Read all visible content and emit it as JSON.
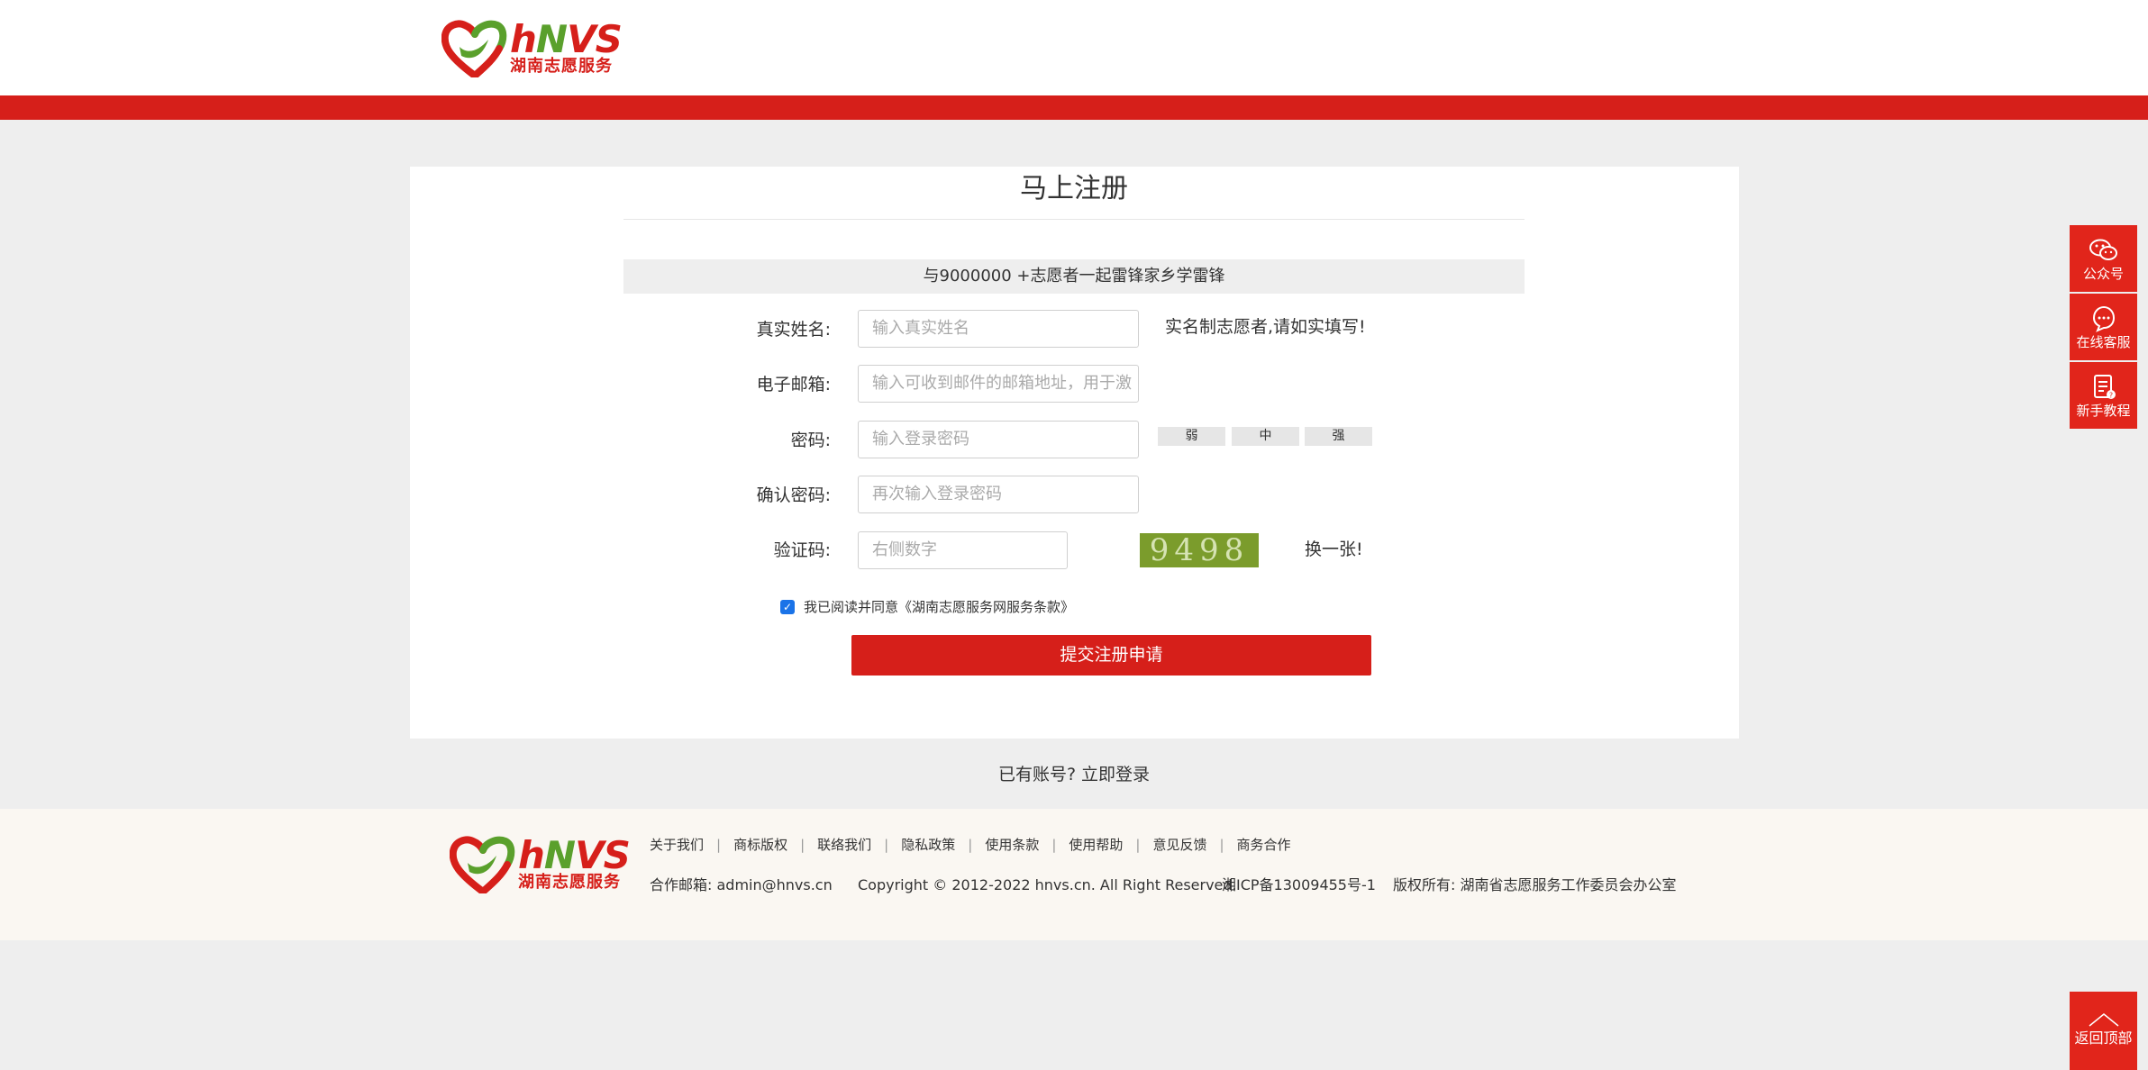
{
  "header": {
    "logo": {
      "brand_h": "h",
      "brand_n": "N",
      "brand_vs": "VS",
      "sub": "湖南志愿服务"
    }
  },
  "colors": {
    "brand_red": "#d61f1a",
    "brand_green": "#5aa02c",
    "side_red": "#e1251b"
  },
  "form": {
    "title": "马上注册",
    "slogan": "与9000000 +志愿者一起雷锋家乡学雷锋",
    "fields": [
      {
        "label": "真实姓名:",
        "placeholder": "输入真实姓名",
        "hint": "实名制志愿者,请如实填写!"
      },
      {
        "label": "电子邮箱:",
        "placeholder": "输入可收到邮件的邮箱地址，用于激"
      },
      {
        "label": "密码:",
        "placeholder": "输入登录密码"
      },
      {
        "label": "确认密码:",
        "placeholder": "再次输入登录密码"
      },
      {
        "label": "验证码:",
        "placeholder": "右侧数字"
      }
    ],
    "strength": [
      "弱",
      "中",
      "强"
    ],
    "captcha_value": "9498",
    "refresh_label": "换一张!",
    "agree_label": "我已阅读并同意《湖南志愿服务网服务条款》",
    "agree_checked": true,
    "submit_label": "提交注册申请"
  },
  "login_link": "已有账号? 立即登录",
  "footer": {
    "logo": {
      "brand_h": "h",
      "brand_n": "N",
      "brand_vs": "VS",
      "sub": "湖南志愿服务"
    },
    "links": [
      "关于我们",
      "商标版权",
      "联络我们",
      "隐私政策",
      "使用条款",
      "使用帮助",
      "意见反馈",
      "商务合作"
    ],
    "email": "合作邮箱:   admin@hnvs.cn",
    "copyright": "Copyright © 2012-2022 hnvs.cn. All Right Reserved.",
    "icp": "湘ICP备13009455号-1",
    "owner": "版权所有: 湖南省志愿服务工作委员会办公室"
  },
  "side": [
    {
      "label": "公众号",
      "icon": "wechat-icon"
    },
    {
      "label": "在线客服",
      "icon": "customer-service-icon"
    },
    {
      "label": "新手教程",
      "icon": "tutorial-icon"
    }
  ],
  "backtop_label": "返回顶部"
}
